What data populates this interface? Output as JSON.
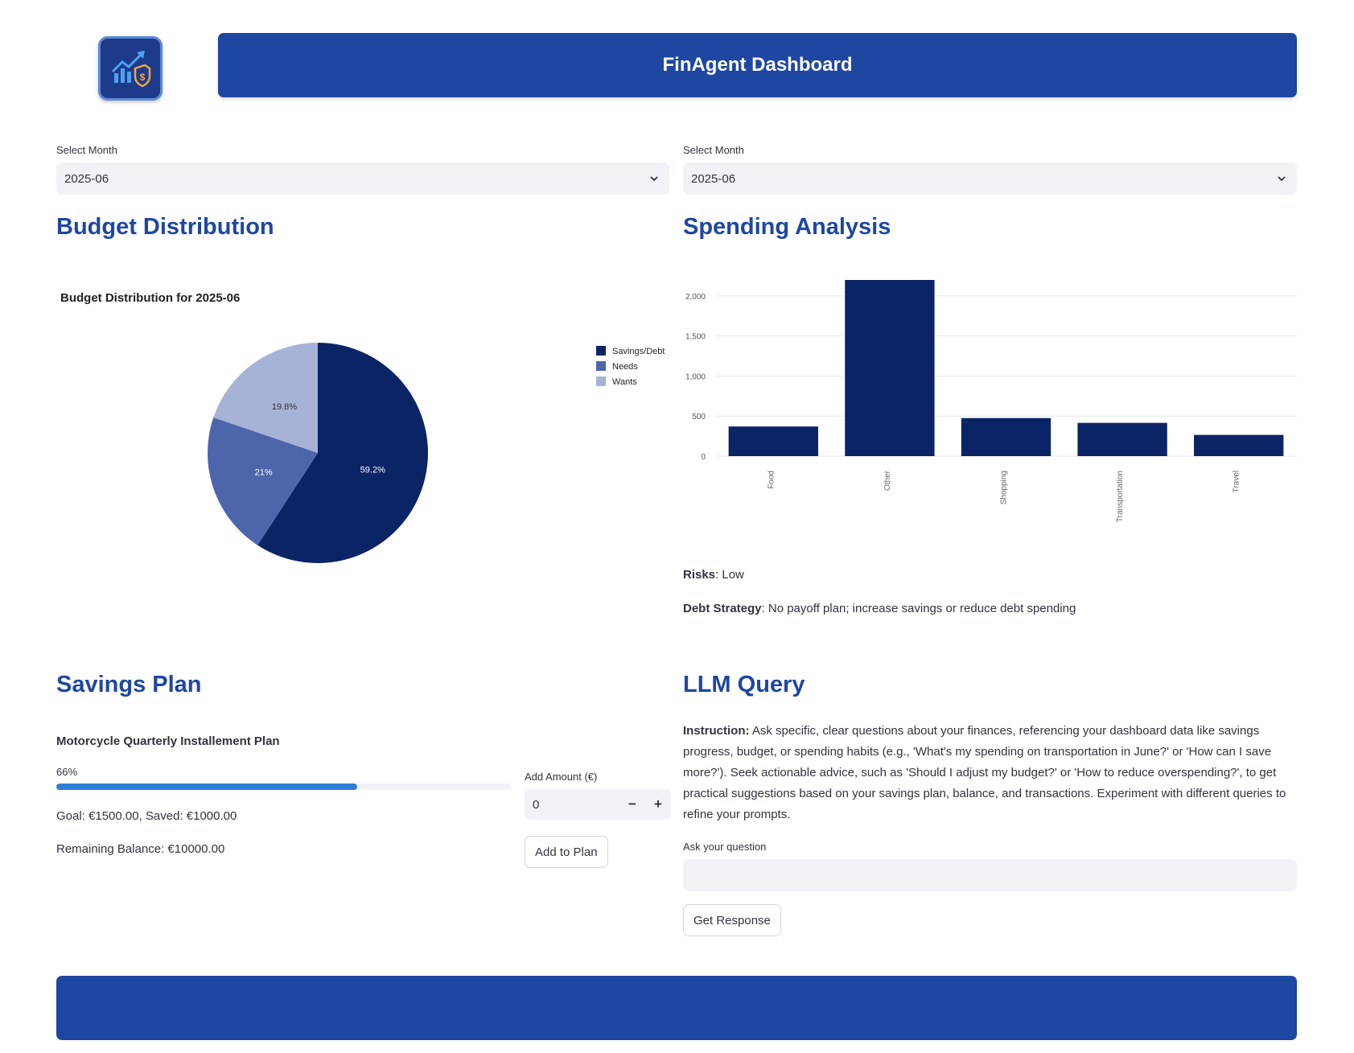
{
  "header": {
    "title": "FinAgent Dashboard",
    "logo_icon": "chart-shield-dollar-icon"
  },
  "left_month": {
    "label": "Select Month",
    "value": "2025-06"
  },
  "right_month": {
    "label": "Select Month",
    "value": "2025-06"
  },
  "budget": {
    "heading": "Budget Distribution"
  },
  "spending": {
    "heading": "Spending Analysis",
    "risks_label": "Risks",
    "risks_value": ": Low",
    "debt_label": "Debt Strategy",
    "debt_value": ": No payoff plan; increase savings or reduce debt spending"
  },
  "savings": {
    "heading": "Savings Plan",
    "plan_title": "Motorcycle Quarterly Installement Plan",
    "progress_label": "66%",
    "progress_value": 0.66,
    "goal_text": "Goal: €1500.00, Saved: €1000.00",
    "remaining_text": "Remaining Balance: €10000.00",
    "add_amount_label": "Add Amount (€)",
    "add_amount_value": "0",
    "minus_symbol": "−",
    "plus_symbol": "+",
    "add_button": "Add to Plan"
  },
  "llm": {
    "heading": "LLM Query",
    "instruction_label": "Instruction:",
    "instruction_text": " Ask specific, clear questions about your finances, referencing your dashboard data like savings progress, budget, or spending habits (e.g., 'What's my spending on transportation in June?' or 'How can I save more?'). Seek actionable advice, such as 'Should I adjust my budget?' or 'How to reduce overspending?', to get practical suggestions based on your savings plan, balance, and transactions. Experiment with different queries to refine your prompts.",
    "question_label": "Ask your question",
    "question_value": "",
    "button": "Get Response"
  },
  "colors": {
    "brand": "#1e47a1",
    "dark_navy": "#0b2466",
    "mid_blue": "#4d66ab",
    "light_blue": "#a7b3d6",
    "progress": "#2f7fd6"
  },
  "chart_data": [
    {
      "type": "pie",
      "title": "Budget Distribution for 2025-06",
      "labels": [
        "Savings/Debt",
        "Needs",
        "Wants"
      ],
      "values": [
        59.2,
        21,
        19.8
      ],
      "value_labels": [
        "59.2%",
        "21%",
        "19.8%"
      ],
      "colors": [
        "#0b2466",
        "#4d66ab",
        "#a7b3d6"
      ],
      "legend": "right"
    },
    {
      "type": "bar",
      "categories": [
        "Food",
        "Other",
        "Shopping",
        "Transportation",
        "Travel"
      ],
      "values": [
        370,
        2200,
        475,
        415,
        265
      ],
      "ylim": [
        0,
        2200
      ],
      "yticks": [
        0,
        500,
        1000,
        1500,
        2000
      ],
      "ytick_labels": [
        "0",
        "500",
        "1,000",
        "1,500",
        "2,000"
      ],
      "grid": true,
      "color": "#0b2466"
    }
  ]
}
